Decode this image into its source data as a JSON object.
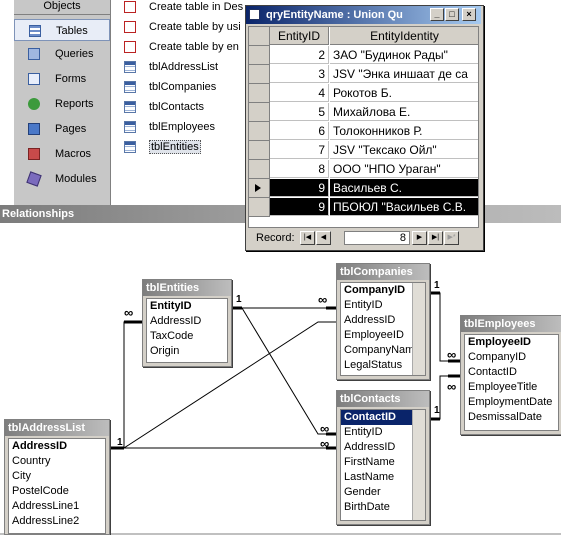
{
  "objects_bar": {
    "header": "Objects",
    "items": [
      {
        "label": "Tables",
        "icon": "tables-icon",
        "selected": true
      },
      {
        "label": "Queries",
        "icon": "queries-icon"
      },
      {
        "label": "Forms",
        "icon": "forms-icon"
      },
      {
        "label": "Reports",
        "icon": "reports-icon"
      },
      {
        "label": "Pages",
        "icon": "pages-icon"
      },
      {
        "label": "Macros",
        "icon": "macros-icon"
      },
      {
        "label": "Modules",
        "icon": "modules-icon"
      }
    ]
  },
  "object_list": {
    "items": [
      {
        "label": "Create table in Des",
        "icon": "wizard-icon"
      },
      {
        "label": "Create table by usi",
        "icon": "wizard-icon"
      },
      {
        "label": "Create table by en",
        "icon": "wizard-icon"
      },
      {
        "label": "tblAddressList",
        "icon": "table-icon"
      },
      {
        "label": "tblCompanies",
        "icon": "table-icon"
      },
      {
        "label": "tblContacts",
        "icon": "table-icon"
      },
      {
        "label": "tblEmployees",
        "icon": "table-icon"
      },
      {
        "label": "tblEntities",
        "icon": "table-icon",
        "selected": true
      }
    ]
  },
  "query_window": {
    "title": "qryEntityName : Union Qu",
    "columns": [
      "EntityID",
      "EntityIdentity"
    ],
    "rows": [
      {
        "id": "2",
        "name": "ЗАО \"Будинок Рады\""
      },
      {
        "id": "3",
        "name": "JSV \"Энка иншаат де са"
      },
      {
        "id": "4",
        "name": "Рокотов Б."
      },
      {
        "id": "5",
        "name": "Михайлова Е."
      },
      {
        "id": "6",
        "name": "Толоконников Р."
      },
      {
        "id": "7",
        "name": "JSV \"Тексако Ойл\""
      },
      {
        "id": "8",
        "name": "ООО \"НПО Ураган\""
      },
      {
        "id": "9",
        "name": "Васильев С."
      },
      {
        "id": "9",
        "name": "ПБОЮЛ \"Васильев С.В."
      }
    ],
    "record_label": "Record:",
    "record_value": "8"
  },
  "relationships": {
    "title": "Relationships",
    "tables": {
      "entities": {
        "title": "tblEntities",
        "fields": [
          "EntityID",
          "AddressID",
          "TaxCode",
          "Origin"
        ]
      },
      "companies": {
        "title": "tblCompanies",
        "fields": [
          "CompanyID",
          "EntityID",
          "AddressID",
          "EmployeeID",
          "CompanyNam",
          "LegalStatus"
        ]
      },
      "employees": {
        "title": "tblEmployees",
        "fields": [
          "EmployeeID",
          "CompanyID",
          "ContactID",
          "EmployeeTitle",
          "EmploymentDate",
          "DesmissalDate"
        ]
      },
      "contacts": {
        "title": "tblContacts",
        "fields": [
          "ContactID",
          "EntityID",
          "AddressID",
          "FirstName",
          "LastName",
          "Gender",
          "BirthDate"
        ]
      },
      "addresslist": {
        "title": "tblAddressList",
        "fields": [
          "AddressID",
          "Country",
          "City",
          "PostelCode",
          "AddressLine1",
          "AddressLine2"
        ]
      }
    },
    "cardinality": {
      "one": "1",
      "many": "∞"
    }
  }
}
